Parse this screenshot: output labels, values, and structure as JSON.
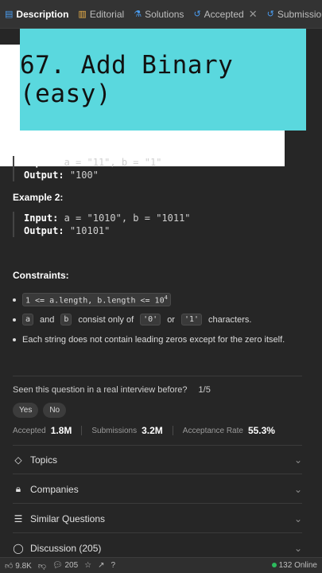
{
  "tabs": [
    {
      "label": "Description",
      "icon": "document-icon",
      "active": true
    },
    {
      "label": "Editorial",
      "icon": "book-icon",
      "active": false
    },
    {
      "label": "Solutions",
      "icon": "flask-icon",
      "active": false
    },
    {
      "label": "Accepted",
      "icon": "history-icon",
      "active": false
    },
    {
      "label": "Submission",
      "icon": "history-icon",
      "active": false
    }
  ],
  "banner": {
    "text": "67. Add Binary (easy)"
  },
  "example1": {
    "input_label": "Input:",
    "input": "a = \"11\", b = \"1\"",
    "output_label": "Output:",
    "output": "\"100\""
  },
  "example2": {
    "title": "Example 2:",
    "input_label": "Input:",
    "input": "a = \"1010\", b = \"1011\"",
    "output_label": "Output:",
    "output": "\"10101\""
  },
  "constraints": {
    "title": "Constraints:",
    "c1_code": "1 <= a.length, b.length <= 10",
    "c1_sup": "4",
    "c2_a": "a",
    "c2_and": "and",
    "c2_b": "b",
    "c2_text": "consist only of",
    "c2_zero": "'0'",
    "c2_or": "or",
    "c2_one": "'1'",
    "c2_end": "characters.",
    "c3": "Each string does not contain leading zeros except for the zero itself."
  },
  "interview": {
    "question": "Seen this question in a real interview before?",
    "count": "1/5",
    "yes": "Yes",
    "no": "No"
  },
  "stats": {
    "accepted_label": "Accepted",
    "accepted": "1.8M",
    "submissions_label": "Submissions",
    "submissions": "3.2M",
    "rate_label": "Acceptance Rate",
    "rate": "55.3%"
  },
  "accordion": [
    {
      "label": "Topics",
      "icon": "tag-icon"
    },
    {
      "label": "Companies",
      "icon": "lock-icon"
    },
    {
      "label": "Similar Questions",
      "icon": "list-icon"
    },
    {
      "label": "Discussion (205)",
      "icon": "chat-icon"
    }
  ],
  "bottom": {
    "likes": "9.8K",
    "comments": "205",
    "online": "132 Online"
  },
  "colors": {
    "banner": "#5ad8de",
    "background": "#262626",
    "online": "#2cbb5d"
  }
}
